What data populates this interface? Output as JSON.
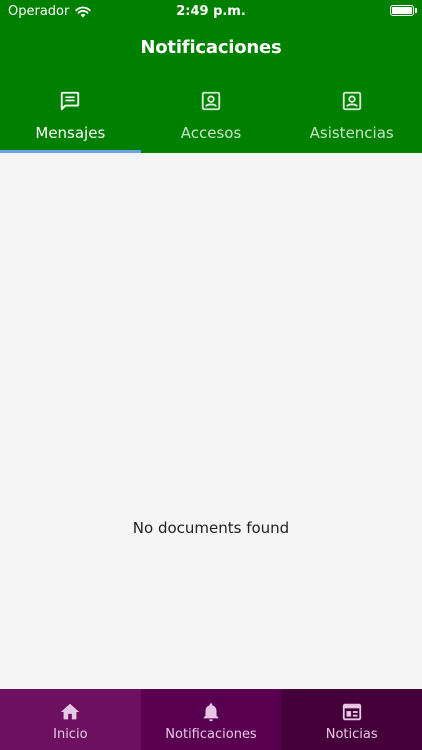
{
  "status_bar": {
    "carrier": "Operador",
    "time": "2:49 p.m."
  },
  "header": {
    "title": "Notificaciones"
  },
  "tabs": [
    {
      "label": "Mensajes",
      "icon": "message-icon",
      "active": true
    },
    {
      "label": "Accesos",
      "icon": "contact-card-icon",
      "active": false
    },
    {
      "label": "Asistencias",
      "icon": "contact-card-icon",
      "active": false
    }
  ],
  "content": {
    "empty_message": "No documents found"
  },
  "bottom_nav": [
    {
      "label": "Inicio",
      "icon": "home-icon"
    },
    {
      "label": "Notificaciones",
      "icon": "bell-icon"
    },
    {
      "label": "Noticias",
      "icon": "news-icon"
    }
  ],
  "colors": {
    "header_green": "#008000",
    "tab_indicator": "#6ea0e6",
    "nav_purple_1": "#6e1060",
    "nav_purple_2": "#5a0050",
    "nav_purple_3": "#440038",
    "content_bg": "#f5f5f5"
  }
}
